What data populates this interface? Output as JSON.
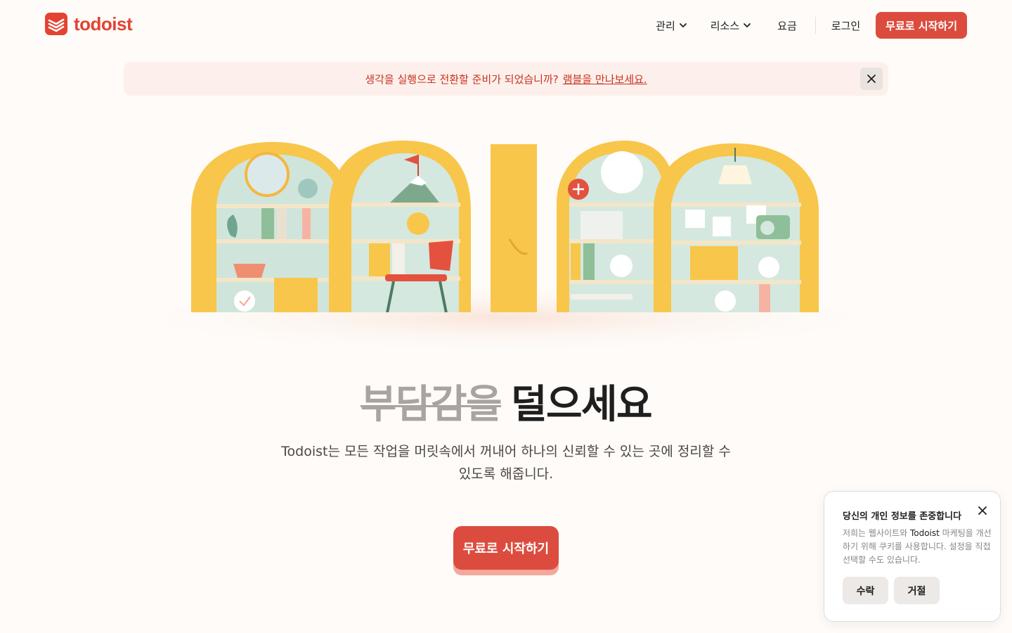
{
  "header": {
    "logo_text": "todoist",
    "nav": [
      {
        "label": "관리",
        "has_dropdown": true
      },
      {
        "label": "리소스",
        "has_dropdown": true
      },
      {
        "label": "요금",
        "has_dropdown": false
      }
    ],
    "login_label": "로그인",
    "cta_label": "무료로 시작하기"
  },
  "announcement": {
    "text": "생각을 실행으로 전환할 준비가 되었습니까?",
    "link_text": "램블을 만나보세요."
  },
  "hero": {
    "headline_struck": "부담감을",
    "headline_main": "덜으세요",
    "subtext": "Todoist는 모든 작업을 머릿속에서 꺼내어 하나의 신뢰할 수 있는 곳에 정리할 수 있도록 해줍니다.",
    "cta_label": "무료로 시작하기"
  },
  "cookie_banner": {
    "title": "당신의 개인 정보를 존중합니다",
    "body_prefix": "저희는 웹사이트와 ",
    "body_brand": "Todoist",
    "body_suffix": " 마케팅을 개선하기 위해 쿠키를 사용합니다. 설정을 직접 선택할 수도 있습니다.",
    "accept_label": "수락",
    "reject_label": "거절"
  },
  "colors": {
    "brand_red": "#dc4c3e",
    "background": "#fefbf8",
    "illustration_yellow": "#f8c64a",
    "illustration_teal": "#b8d8cc"
  }
}
